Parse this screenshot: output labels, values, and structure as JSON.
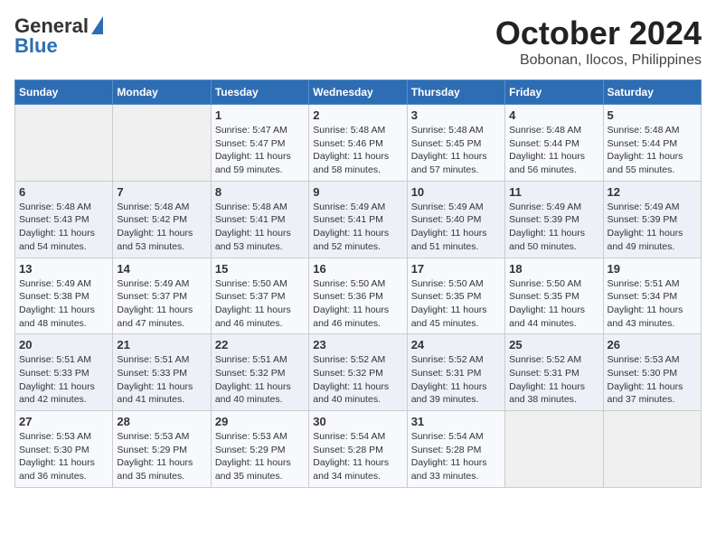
{
  "header": {
    "logo_line1": "General",
    "logo_line2": "Blue",
    "title": "October 2024",
    "subtitle": "Bobonan, Ilocos, Philippines"
  },
  "days_of_week": [
    "Sunday",
    "Monday",
    "Tuesday",
    "Wednesday",
    "Thursday",
    "Friday",
    "Saturday"
  ],
  "weeks": [
    [
      {
        "day": "",
        "info": ""
      },
      {
        "day": "",
        "info": ""
      },
      {
        "day": "1",
        "info": "Sunrise: 5:47 AM\nSunset: 5:47 PM\nDaylight: 11 hours and 59 minutes."
      },
      {
        "day": "2",
        "info": "Sunrise: 5:48 AM\nSunset: 5:46 PM\nDaylight: 11 hours and 58 minutes."
      },
      {
        "day": "3",
        "info": "Sunrise: 5:48 AM\nSunset: 5:45 PM\nDaylight: 11 hours and 57 minutes."
      },
      {
        "day": "4",
        "info": "Sunrise: 5:48 AM\nSunset: 5:44 PM\nDaylight: 11 hours and 56 minutes."
      },
      {
        "day": "5",
        "info": "Sunrise: 5:48 AM\nSunset: 5:44 PM\nDaylight: 11 hours and 55 minutes."
      }
    ],
    [
      {
        "day": "6",
        "info": "Sunrise: 5:48 AM\nSunset: 5:43 PM\nDaylight: 11 hours and 54 minutes."
      },
      {
        "day": "7",
        "info": "Sunrise: 5:48 AM\nSunset: 5:42 PM\nDaylight: 11 hours and 53 minutes."
      },
      {
        "day": "8",
        "info": "Sunrise: 5:48 AM\nSunset: 5:41 PM\nDaylight: 11 hours and 53 minutes."
      },
      {
        "day": "9",
        "info": "Sunrise: 5:49 AM\nSunset: 5:41 PM\nDaylight: 11 hours and 52 minutes."
      },
      {
        "day": "10",
        "info": "Sunrise: 5:49 AM\nSunset: 5:40 PM\nDaylight: 11 hours and 51 minutes."
      },
      {
        "day": "11",
        "info": "Sunrise: 5:49 AM\nSunset: 5:39 PM\nDaylight: 11 hours and 50 minutes."
      },
      {
        "day": "12",
        "info": "Sunrise: 5:49 AM\nSunset: 5:39 PM\nDaylight: 11 hours and 49 minutes."
      }
    ],
    [
      {
        "day": "13",
        "info": "Sunrise: 5:49 AM\nSunset: 5:38 PM\nDaylight: 11 hours and 48 minutes."
      },
      {
        "day": "14",
        "info": "Sunrise: 5:49 AM\nSunset: 5:37 PM\nDaylight: 11 hours and 47 minutes."
      },
      {
        "day": "15",
        "info": "Sunrise: 5:50 AM\nSunset: 5:37 PM\nDaylight: 11 hours and 46 minutes."
      },
      {
        "day": "16",
        "info": "Sunrise: 5:50 AM\nSunset: 5:36 PM\nDaylight: 11 hours and 46 minutes."
      },
      {
        "day": "17",
        "info": "Sunrise: 5:50 AM\nSunset: 5:35 PM\nDaylight: 11 hours and 45 minutes."
      },
      {
        "day": "18",
        "info": "Sunrise: 5:50 AM\nSunset: 5:35 PM\nDaylight: 11 hours and 44 minutes."
      },
      {
        "day": "19",
        "info": "Sunrise: 5:51 AM\nSunset: 5:34 PM\nDaylight: 11 hours and 43 minutes."
      }
    ],
    [
      {
        "day": "20",
        "info": "Sunrise: 5:51 AM\nSunset: 5:33 PM\nDaylight: 11 hours and 42 minutes."
      },
      {
        "day": "21",
        "info": "Sunrise: 5:51 AM\nSunset: 5:33 PM\nDaylight: 11 hours and 41 minutes."
      },
      {
        "day": "22",
        "info": "Sunrise: 5:51 AM\nSunset: 5:32 PM\nDaylight: 11 hours and 40 minutes."
      },
      {
        "day": "23",
        "info": "Sunrise: 5:52 AM\nSunset: 5:32 PM\nDaylight: 11 hours and 40 minutes."
      },
      {
        "day": "24",
        "info": "Sunrise: 5:52 AM\nSunset: 5:31 PM\nDaylight: 11 hours and 39 minutes."
      },
      {
        "day": "25",
        "info": "Sunrise: 5:52 AM\nSunset: 5:31 PM\nDaylight: 11 hours and 38 minutes."
      },
      {
        "day": "26",
        "info": "Sunrise: 5:53 AM\nSunset: 5:30 PM\nDaylight: 11 hours and 37 minutes."
      }
    ],
    [
      {
        "day": "27",
        "info": "Sunrise: 5:53 AM\nSunset: 5:30 PM\nDaylight: 11 hours and 36 minutes."
      },
      {
        "day": "28",
        "info": "Sunrise: 5:53 AM\nSunset: 5:29 PM\nDaylight: 11 hours and 35 minutes."
      },
      {
        "day": "29",
        "info": "Sunrise: 5:53 AM\nSunset: 5:29 PM\nDaylight: 11 hours and 35 minutes."
      },
      {
        "day": "30",
        "info": "Sunrise: 5:54 AM\nSunset: 5:28 PM\nDaylight: 11 hours and 34 minutes."
      },
      {
        "day": "31",
        "info": "Sunrise: 5:54 AM\nSunset: 5:28 PM\nDaylight: 11 hours and 33 minutes."
      },
      {
        "day": "",
        "info": ""
      },
      {
        "day": "",
        "info": ""
      }
    ]
  ]
}
